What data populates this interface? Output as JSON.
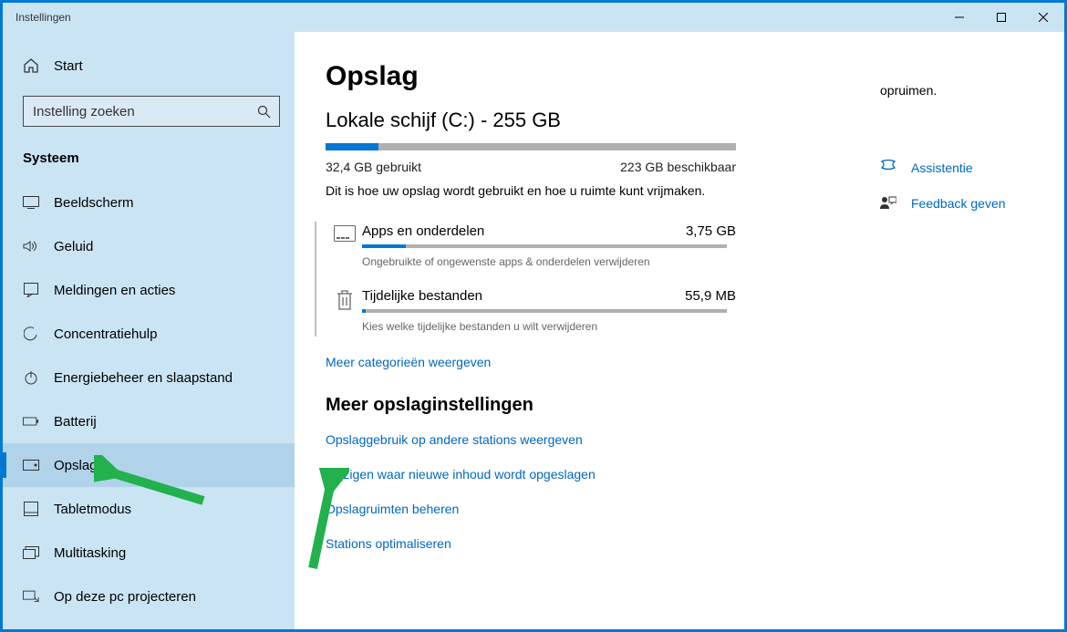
{
  "window": {
    "title": "Instellingen"
  },
  "sidebar": {
    "home": "Start",
    "search_placeholder": "Instelling zoeken",
    "section": "Systeem",
    "items": [
      {
        "label": "Beeldscherm"
      },
      {
        "label": "Geluid"
      },
      {
        "label": "Meldingen en acties"
      },
      {
        "label": "Concentratiehulp"
      },
      {
        "label": "Energiebeheer en slaapstand"
      },
      {
        "label": "Batterij"
      },
      {
        "label": "Opslag"
      },
      {
        "label": "Tabletmodus"
      },
      {
        "label": "Multitasking"
      },
      {
        "label": "Op deze pc projecteren"
      }
    ]
  },
  "page": {
    "title": "Opslag",
    "disk_title": "Lokale schijf (C:) - 255 GB",
    "used": "32,4 GB gebruikt",
    "free": "223 GB beschikbaar",
    "description": "Dit is hoe uw opslag wordt gebruikt en hoe u ruimte kunt vrijmaken.",
    "categories": [
      {
        "name": "Apps en onderdelen",
        "size": "3,75 GB",
        "hint": "Ongebruikte of ongewenste apps & onderdelen verwijderen",
        "fill_pct": 12
      },
      {
        "name": "Tijdelijke bestanden",
        "size": "55,9 MB",
        "hint": "Kies welke tijdelijke bestanden u wilt verwijderen",
        "fill_pct": 1
      }
    ],
    "more_categories": "Meer categorieën weergeven",
    "section2": "Meer opslaginstellingen",
    "links": [
      "Opslaggebruik op andere stations weergeven",
      "Wijzigen waar nieuwe inhoud wordt opgeslagen",
      "Opslagruimten beheren",
      "Stations optimaliseren"
    ]
  },
  "rightside": {
    "opruimen": "opruimen.",
    "help": "Assistentie",
    "feedback": "Feedback geven"
  }
}
